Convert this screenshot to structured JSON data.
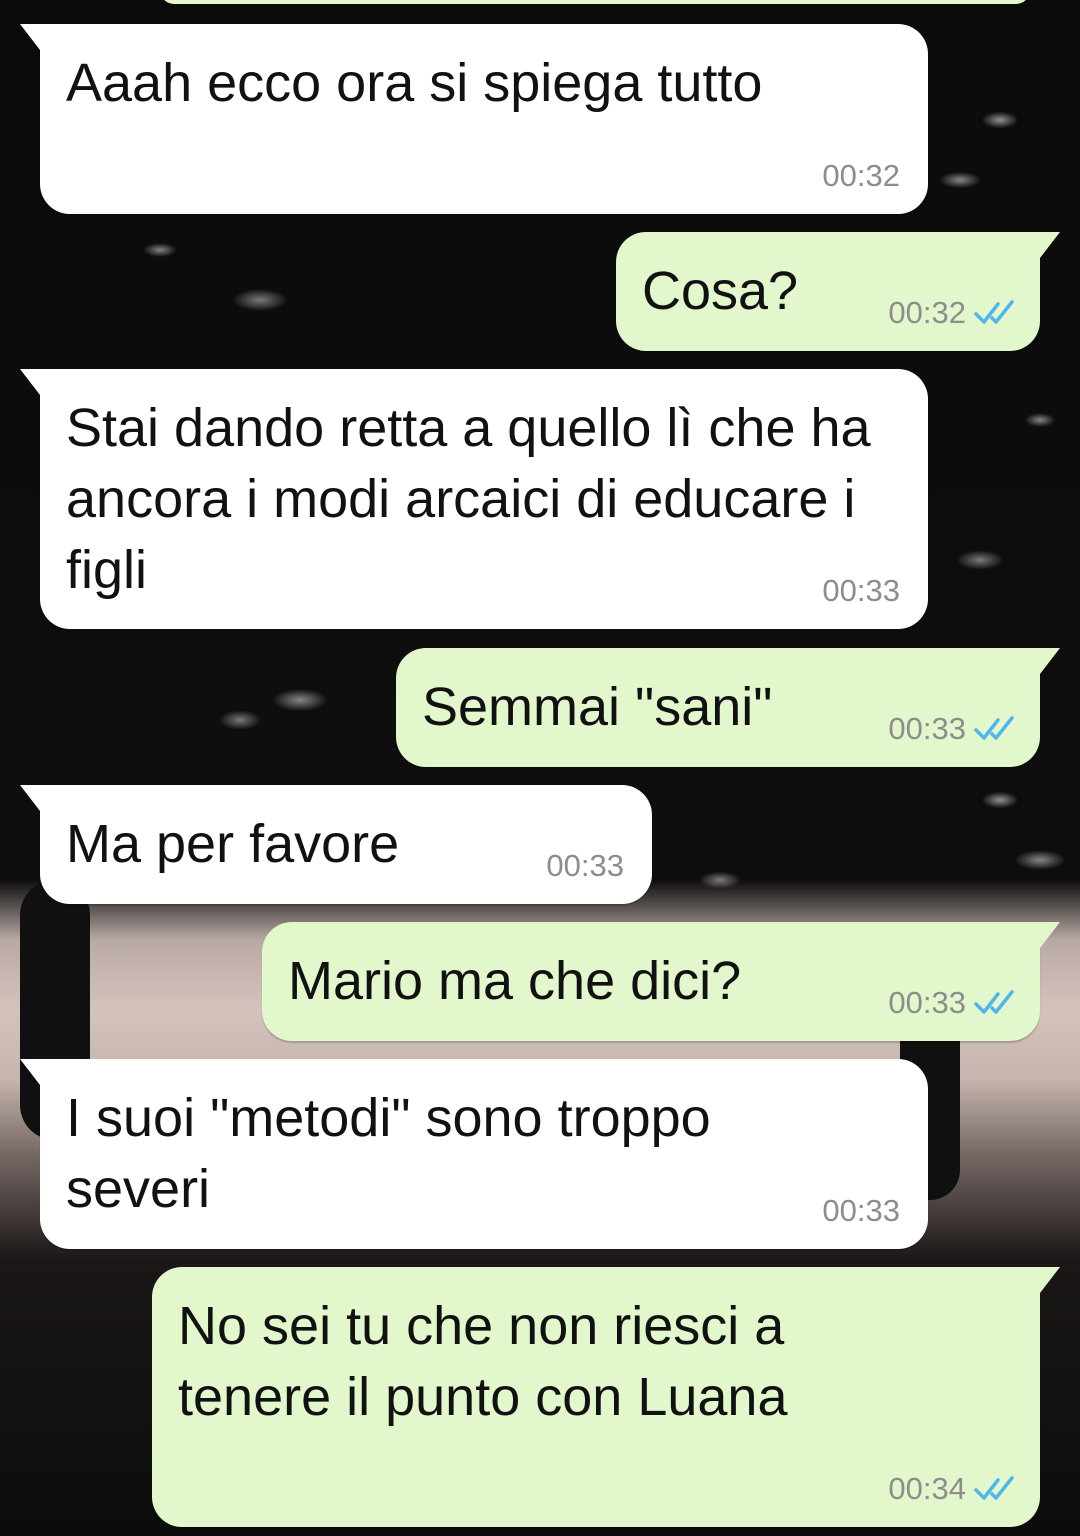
{
  "chat": {
    "messages": [
      {
        "direction": "incoming",
        "text": "Aaah ecco ora si spiega tutto",
        "time": "00:32"
      },
      {
        "direction": "outgoing",
        "text": "Cosa?",
        "time": "00:32",
        "status": "read"
      },
      {
        "direction": "incoming",
        "text": "Stai dando retta a quello lì che ha ancora i modi arcaici di educare i figli",
        "time": "00:33"
      },
      {
        "direction": "outgoing",
        "text": "Semmai \"sani\"",
        "time": "00:33",
        "status": "read"
      },
      {
        "direction": "incoming",
        "text": "Ma per favore",
        "time": "00:33"
      },
      {
        "direction": "outgoing",
        "text": "Mario ma che dici?",
        "time": "00:33",
        "status": "read"
      },
      {
        "direction": "incoming",
        "text": "I suoi \"metodi\" sono troppo severi",
        "time": "00:33"
      },
      {
        "direction": "outgoing",
        "text": "No sei tu che non riesci a tenere il punto con Luana",
        "time": "00:34",
        "status": "read"
      }
    ],
    "colors": {
      "incoming_bubble": "#ffffff",
      "outgoing_bubble": "#e2f7cb",
      "read_ticks": "#4fb6ec",
      "timestamp": "#8d8d8d"
    },
    "icons": {
      "read_status": "double-check-icon"
    }
  }
}
